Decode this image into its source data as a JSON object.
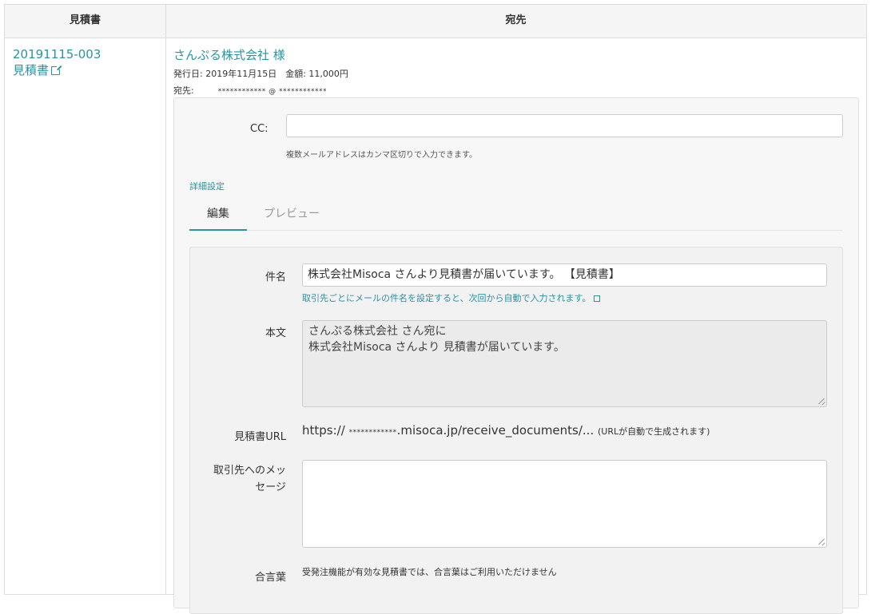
{
  "table": {
    "header_quote": "見積書",
    "header_recipient": "宛先"
  },
  "quote": {
    "number": "20191115-003",
    "link_label": "見積書"
  },
  "recipient": {
    "client_name": "さんぷる株式会社 様",
    "issue_info": "発行日: 2019年11月15日　金額: 11,000円",
    "to_label": "宛先:",
    "to_value": "************ @ ************"
  },
  "form": {
    "cc_label": "CC:",
    "cc_value": "",
    "cc_help": "複数メールアドレスはカンマ区切りで入力できます。",
    "detail_settings": "詳細設定",
    "tabs": [
      "編集",
      "プレビュー"
    ],
    "subject_label": "件名",
    "subject_value": "株式会社Misoca さんより見積書が届いています。 【見積書】",
    "subject_help": "取引先ごとにメールの件名を設定すると、次回から自動で入力されます。",
    "body_label": "本文",
    "body_line1": "さんぷる株式会社 さん宛に",
    "body_line2": "株式会社Misoca さんより 見積書が届いています。",
    "url_label": "見積書URL",
    "url_prefix": "https://",
    "url_masked": "************",
    "url_suffix": ".misoca.jp/receive_documents/...",
    "url_note": "(URLが自動で生成されます)",
    "message_label_line1": "取引先へのメッ",
    "message_label_line2": "セージ",
    "message_value": "",
    "closing_label": "合言葉",
    "closing_note": "受発注機能が有効な見積書では、合言葉はご利用いただけません"
  },
  "colors": {
    "accent": "#2a93a1",
    "header_bg": "#f5f5f5",
    "panel_bg": "#f7f7f7"
  }
}
